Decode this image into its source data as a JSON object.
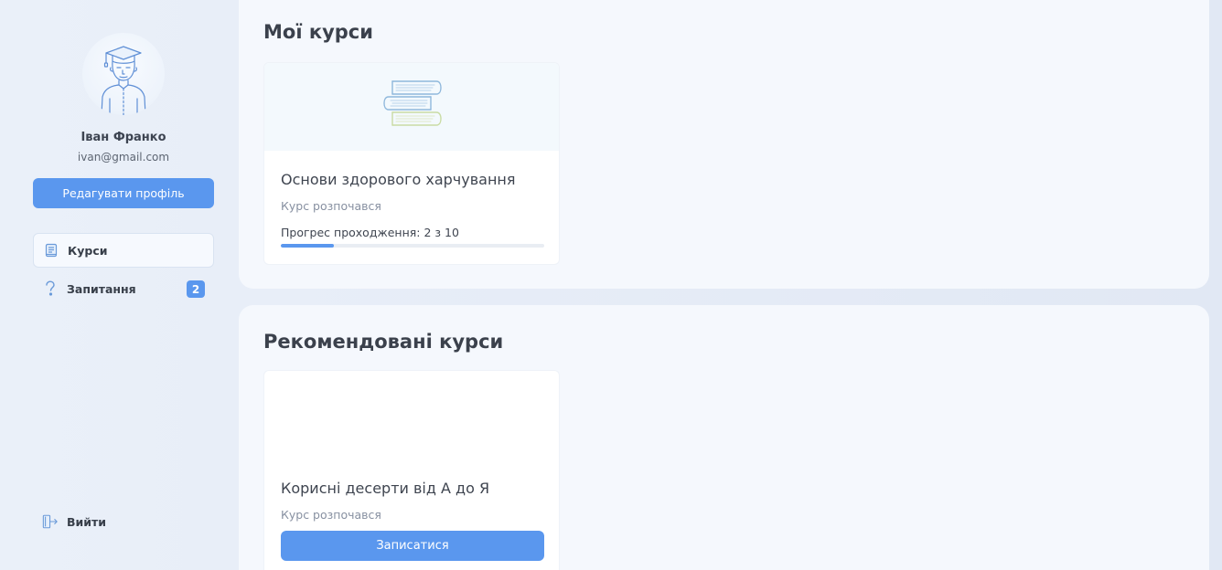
{
  "user": {
    "name": "Іван Франко",
    "email": "ivan@gmail.com",
    "edit_label": "Редагувати профіль",
    "avatar_icon": "graduate-avatar-icon"
  },
  "nav": {
    "items": [
      {
        "label": "Курси",
        "icon": "book-icon",
        "active": true
      },
      {
        "label": "Запитання",
        "icon": "question-icon",
        "badge": "2"
      }
    ],
    "logout_label": "Вийти",
    "logout_icon": "logout-icon"
  },
  "my_courses": {
    "title": "Мої курси",
    "cards": [
      {
        "title": "Основи здорового харчування",
        "status": "Курс розпочався",
        "progress_label": "Прогрес проходження: 2 з 10",
        "progress": 0.2,
        "media_icon": "books-stack-icon"
      }
    ]
  },
  "recommended": {
    "title": "Рекомендовані курси",
    "cards": [
      {
        "title": "Корисні десерти від А до Я",
        "status": "Курс розпочався",
        "enroll_label": "Записатися"
      }
    ]
  },
  "colors": {
    "accent": "#5a97ee",
    "panel": "#f5f8fd",
    "background": "#e4ebf6"
  }
}
